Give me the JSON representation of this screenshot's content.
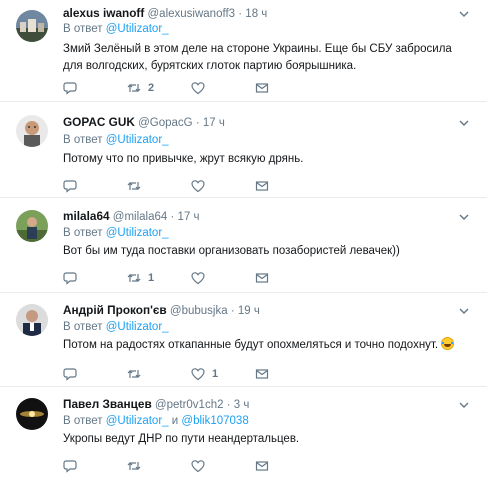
{
  "reply_prefix": "В ответ",
  "tweets": [
    {
      "name": "alexus iwanoff",
      "handle": "@alexusiwanoff3",
      "dot": "·",
      "time": "18 ч",
      "mention": "@Utilizator_",
      "text": "Змий Зелёный в этом деле на стороне Украины. Еще бы СБУ забросила для волгодских, бурятских глоток партию боярышника.",
      "replies": "",
      "retweets": "2",
      "likes": ""
    },
    {
      "name": "GOPAC GUK",
      "handle": "@GopacG",
      "dot": "·",
      "time": "17 ч",
      "mention": "@Utilizator_",
      "text": "Потому что по привычке, жрут всякую дрянь.",
      "replies": "",
      "retweets": "",
      "likes": ""
    },
    {
      "name": "milala64",
      "handle": "@milala64",
      "dot": "·",
      "time": "17 ч",
      "mention": "@Utilizator_",
      "text": "Вот бы им туда поставки организовать позабористей левачек))",
      "replies": "",
      "retweets": "1",
      "likes": ""
    },
    {
      "name": "Андрій Прокоп'єв",
      "handle": "@bubusjka",
      "dot": "·",
      "time": "19 ч",
      "mention": "@Utilizator_",
      "text": "Потом на радостях откапанные будут опохмеляться и точно подохнут.",
      "replies": "",
      "retweets": "",
      "likes": "1"
    },
    {
      "name": "Павел Званцев",
      "handle": "@petr0v1ch2",
      "dot": "·",
      "time": "3 ч",
      "mention": "@Utilizator_",
      "mention_and": "и",
      "mention2": "@blik107038",
      "text": "Укропы ведут ДНР по пути неандертальцев.",
      "replies": "",
      "retweets": "",
      "likes": ""
    }
  ],
  "icons": {
    "reply": "reply-icon",
    "retweet": "retweet-icon",
    "like": "heart-icon",
    "dm": "envelope-icon",
    "caret": "chevron-down-icon"
  },
  "colors": {
    "link": "#1da1f2",
    "muted": "#657786",
    "divider": "#e6ecf0"
  }
}
